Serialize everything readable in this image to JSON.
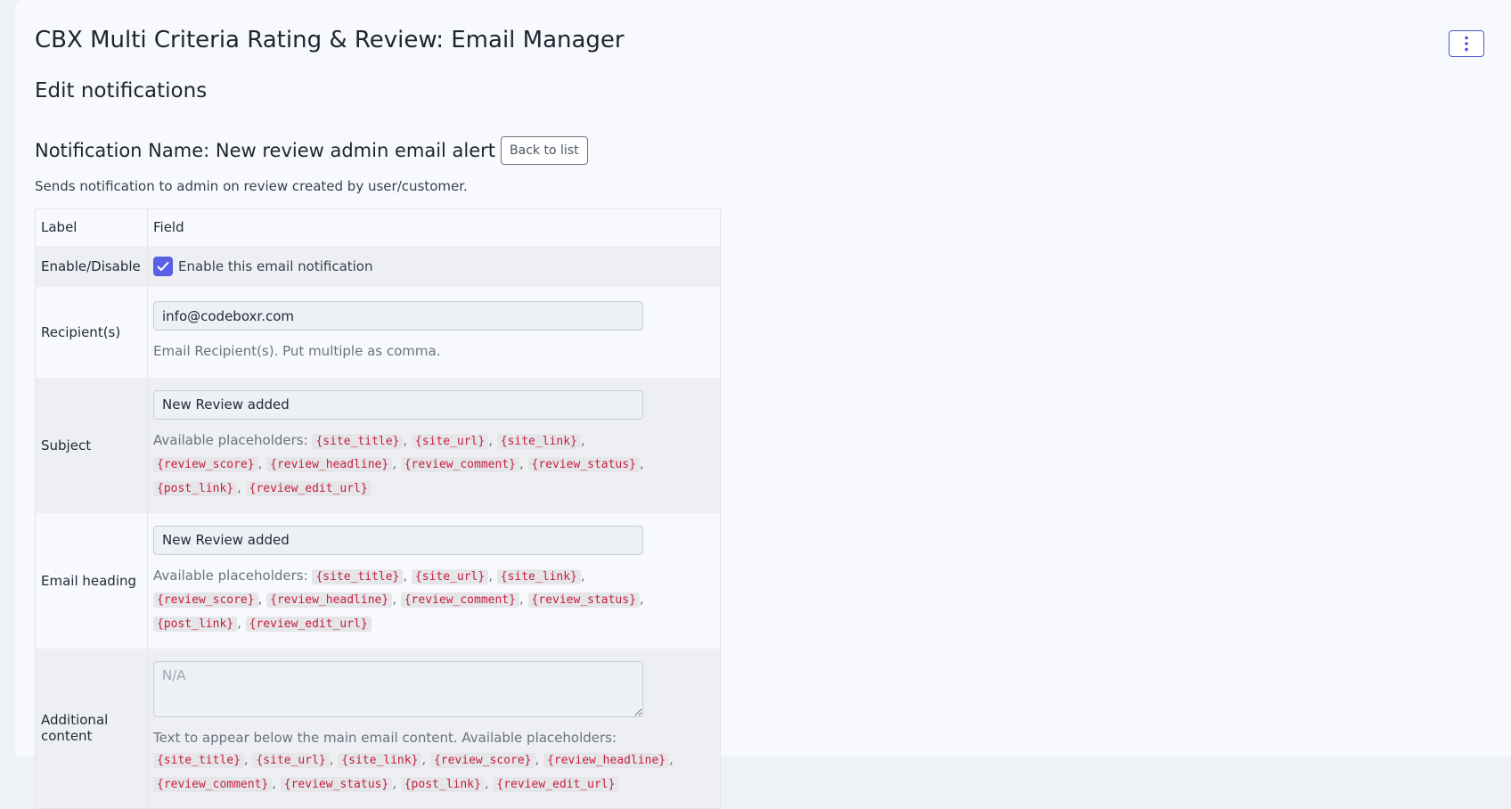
{
  "header": {
    "title": "CBX Multi Criteria Rating & Review: Email Manager",
    "menu_icon": "vertical-ellipsis-icon",
    "accent_color": "#4b58d6"
  },
  "section": {
    "title": "Edit notifications"
  },
  "notification": {
    "name_title": "Notification Name: New review admin email alert",
    "back_label": "Back to list",
    "description": "Sends notification to admin on review created by user/customer."
  },
  "table": {
    "col_label": "Label",
    "col_field": "Field",
    "enable": {
      "label": "Enable/Disable",
      "checkbox_label": "Enable this email notification",
      "checked": true
    },
    "recipient": {
      "label": "Recipient(s)",
      "value": "info@codeboxr.com",
      "help": "Email Recipient(s). Put multiple as comma."
    },
    "subject": {
      "label": "Subject",
      "value": "New Review added",
      "help_prefix": "Available placeholders:"
    },
    "heading": {
      "label": "Email heading",
      "value": "New Review added",
      "help_prefix": "Available placeholders:"
    },
    "additional": {
      "label": "Additional content",
      "placeholder": "N/A",
      "help_prefix": "Text to appear below the main email content. Available placeholders:"
    },
    "placeholders": [
      "{site_title}",
      "{site_url}",
      "{site_link}",
      "{review_score}",
      "{review_headline}",
      "{review_comment}",
      "{review_status}",
      "{post_link}",
      "{review_edit_url}"
    ]
  }
}
